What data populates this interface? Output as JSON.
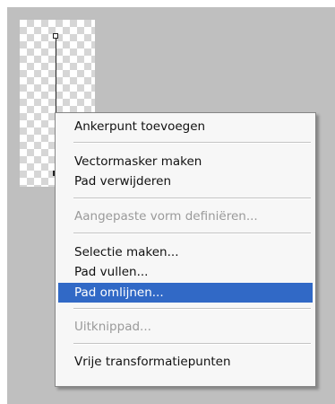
{
  "context_menu": {
    "items": [
      {
        "label": "Ankerpunt toevoegen",
        "enabled": true
      },
      {
        "label": "Vectormasker maken",
        "enabled": true
      },
      {
        "label": "Pad verwijderen",
        "enabled": true
      },
      {
        "label": "Aangepaste vorm definiëren...",
        "enabled": false
      },
      {
        "label": "Selectie maken...",
        "enabled": true
      },
      {
        "label": "Pad vullen...",
        "enabled": true
      },
      {
        "label": "Pad omlijnen...",
        "enabled": true,
        "highlighted": true
      },
      {
        "label": "Uitknippad...",
        "enabled": false
      },
      {
        "label": "Vrije transformatiepunten",
        "enabled": true
      }
    ],
    "highlight_color": "#3169c6"
  },
  "canvas": {
    "background_color": "#bfbfbf",
    "transparency_pattern": "checkerboard"
  }
}
